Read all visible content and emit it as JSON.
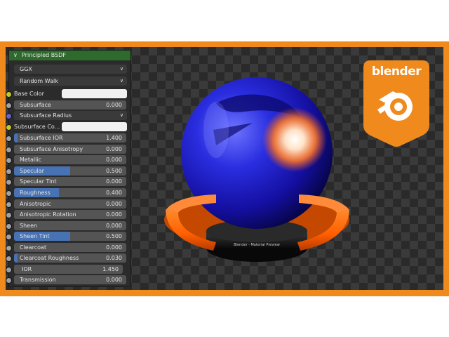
{
  "logo": {
    "text": "blender"
  },
  "panel": {
    "header": "Principled BSDF",
    "distribution": "GGX",
    "subsurface_method": "Random Walk",
    "base_color_label": "Base Color",
    "subsurface_radius_label": "Subsurface Radius",
    "subsurface_color_label": "Subsurface Co...",
    "fields": [
      {
        "label": "Subsurface",
        "value": "0.000",
        "fill": 0
      },
      {
        "label": "Subsurface IOR",
        "value": "1.400",
        "fill": 0.03
      },
      {
        "label": "Subsurface Anisotropy",
        "value": "0.000",
        "fill": 0
      },
      {
        "label": "Metallic",
        "value": "0.000",
        "fill": 0
      },
      {
        "label": "Specular",
        "value": "0.500",
        "fill": 0.5
      },
      {
        "label": "Specular Tint",
        "value": "0.000",
        "fill": 0
      },
      {
        "label": "Roughness",
        "value": "0.400",
        "fill": 0.4
      },
      {
        "label": "Anisotropic",
        "value": "0.000",
        "fill": 0
      },
      {
        "label": "Anisotropic Rotation",
        "value": "0.000",
        "fill": 0
      },
      {
        "label": "Sheen",
        "value": "0.000",
        "fill": 0
      },
      {
        "label": "Sheen Tint",
        "value": "0.500",
        "fill": 0.5
      },
      {
        "label": "Clearcoat",
        "value": "0.000",
        "fill": 0
      },
      {
        "label": "Clearcoat Roughness",
        "value": "0.030",
        "fill": 0.03
      },
      {
        "label": "IOR",
        "value": "1.450",
        "fill": 0
      },
      {
        "label": "Transmission",
        "value": "0.000",
        "fill": 0
      }
    ]
  },
  "colors": {
    "frame": "#f08a1c",
    "header": "#2f6a2d",
    "slider_fill": "#4772b3",
    "base_color": "#f1f1f1"
  },
  "render": {
    "stand_text": "Blender - Material Preview"
  }
}
